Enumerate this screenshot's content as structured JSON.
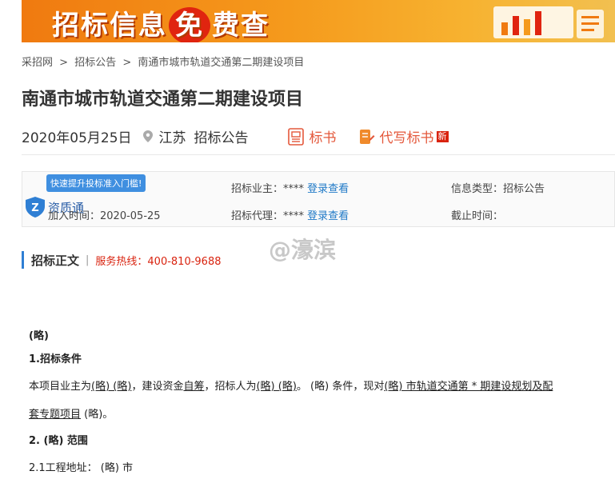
{
  "banner": {
    "text_pre": "招标信息",
    "text_free": "免",
    "text_post": "费查"
  },
  "breadcrumb": {
    "items": [
      "采招网",
      ">",
      "招标公告",
      ">",
      "南通市城市轨道交通第二期建设项目"
    ]
  },
  "page_title": "南通市城市轨道交通第二期建设项目",
  "meta": {
    "date": "2020年05月25日",
    "region": "江苏",
    "type": "招标公告",
    "btn_bid_doc": "标书",
    "btn_write_doc": "代写标书",
    "new_badge": "新"
  },
  "info": {
    "tooltip": "快速提升投标准入门槛!",
    "qual_label": "资质通",
    "add_time_label": "加入时间：",
    "add_time_value": "2020-05-25",
    "owner_label": "招标业主：****",
    "owner_link": "登录查看",
    "agent_label": "招标代理：****",
    "agent_link": "登录查看",
    "info_type_label": "信息类型：",
    "info_type_value": "招标公告",
    "deadline_label": "截止时间："
  },
  "section": {
    "heading": "招标正文",
    "sep": "|",
    "hotline": "服务热线：400-810-9688"
  },
  "watermark": "@濠滨",
  "content": {
    "l0": "(略)",
    "l1": "1.招标条件",
    "p1a": "本项目业主为",
    "p1b": "(略) (略)",
    "p1c": "，建设资金",
    "p1d": "自筹",
    "p1e": "，招标人为",
    "p1f": "(略) (略)",
    "p1g": "。 (略) 条件，现对",
    "p1h": "(略) 市轨道交通第 * 期建设规划及配",
    "p2a": "套专题项目",
    "p2b": " (略)。",
    "l2": "2. (略) 范围",
    "l3": "2.1工程地址： (略) 市"
  },
  "colors": {
    "accent_blue": "#2f7fd4",
    "link_blue": "#1f79c7",
    "red": "#d9230f",
    "orange": "#e4583b"
  }
}
